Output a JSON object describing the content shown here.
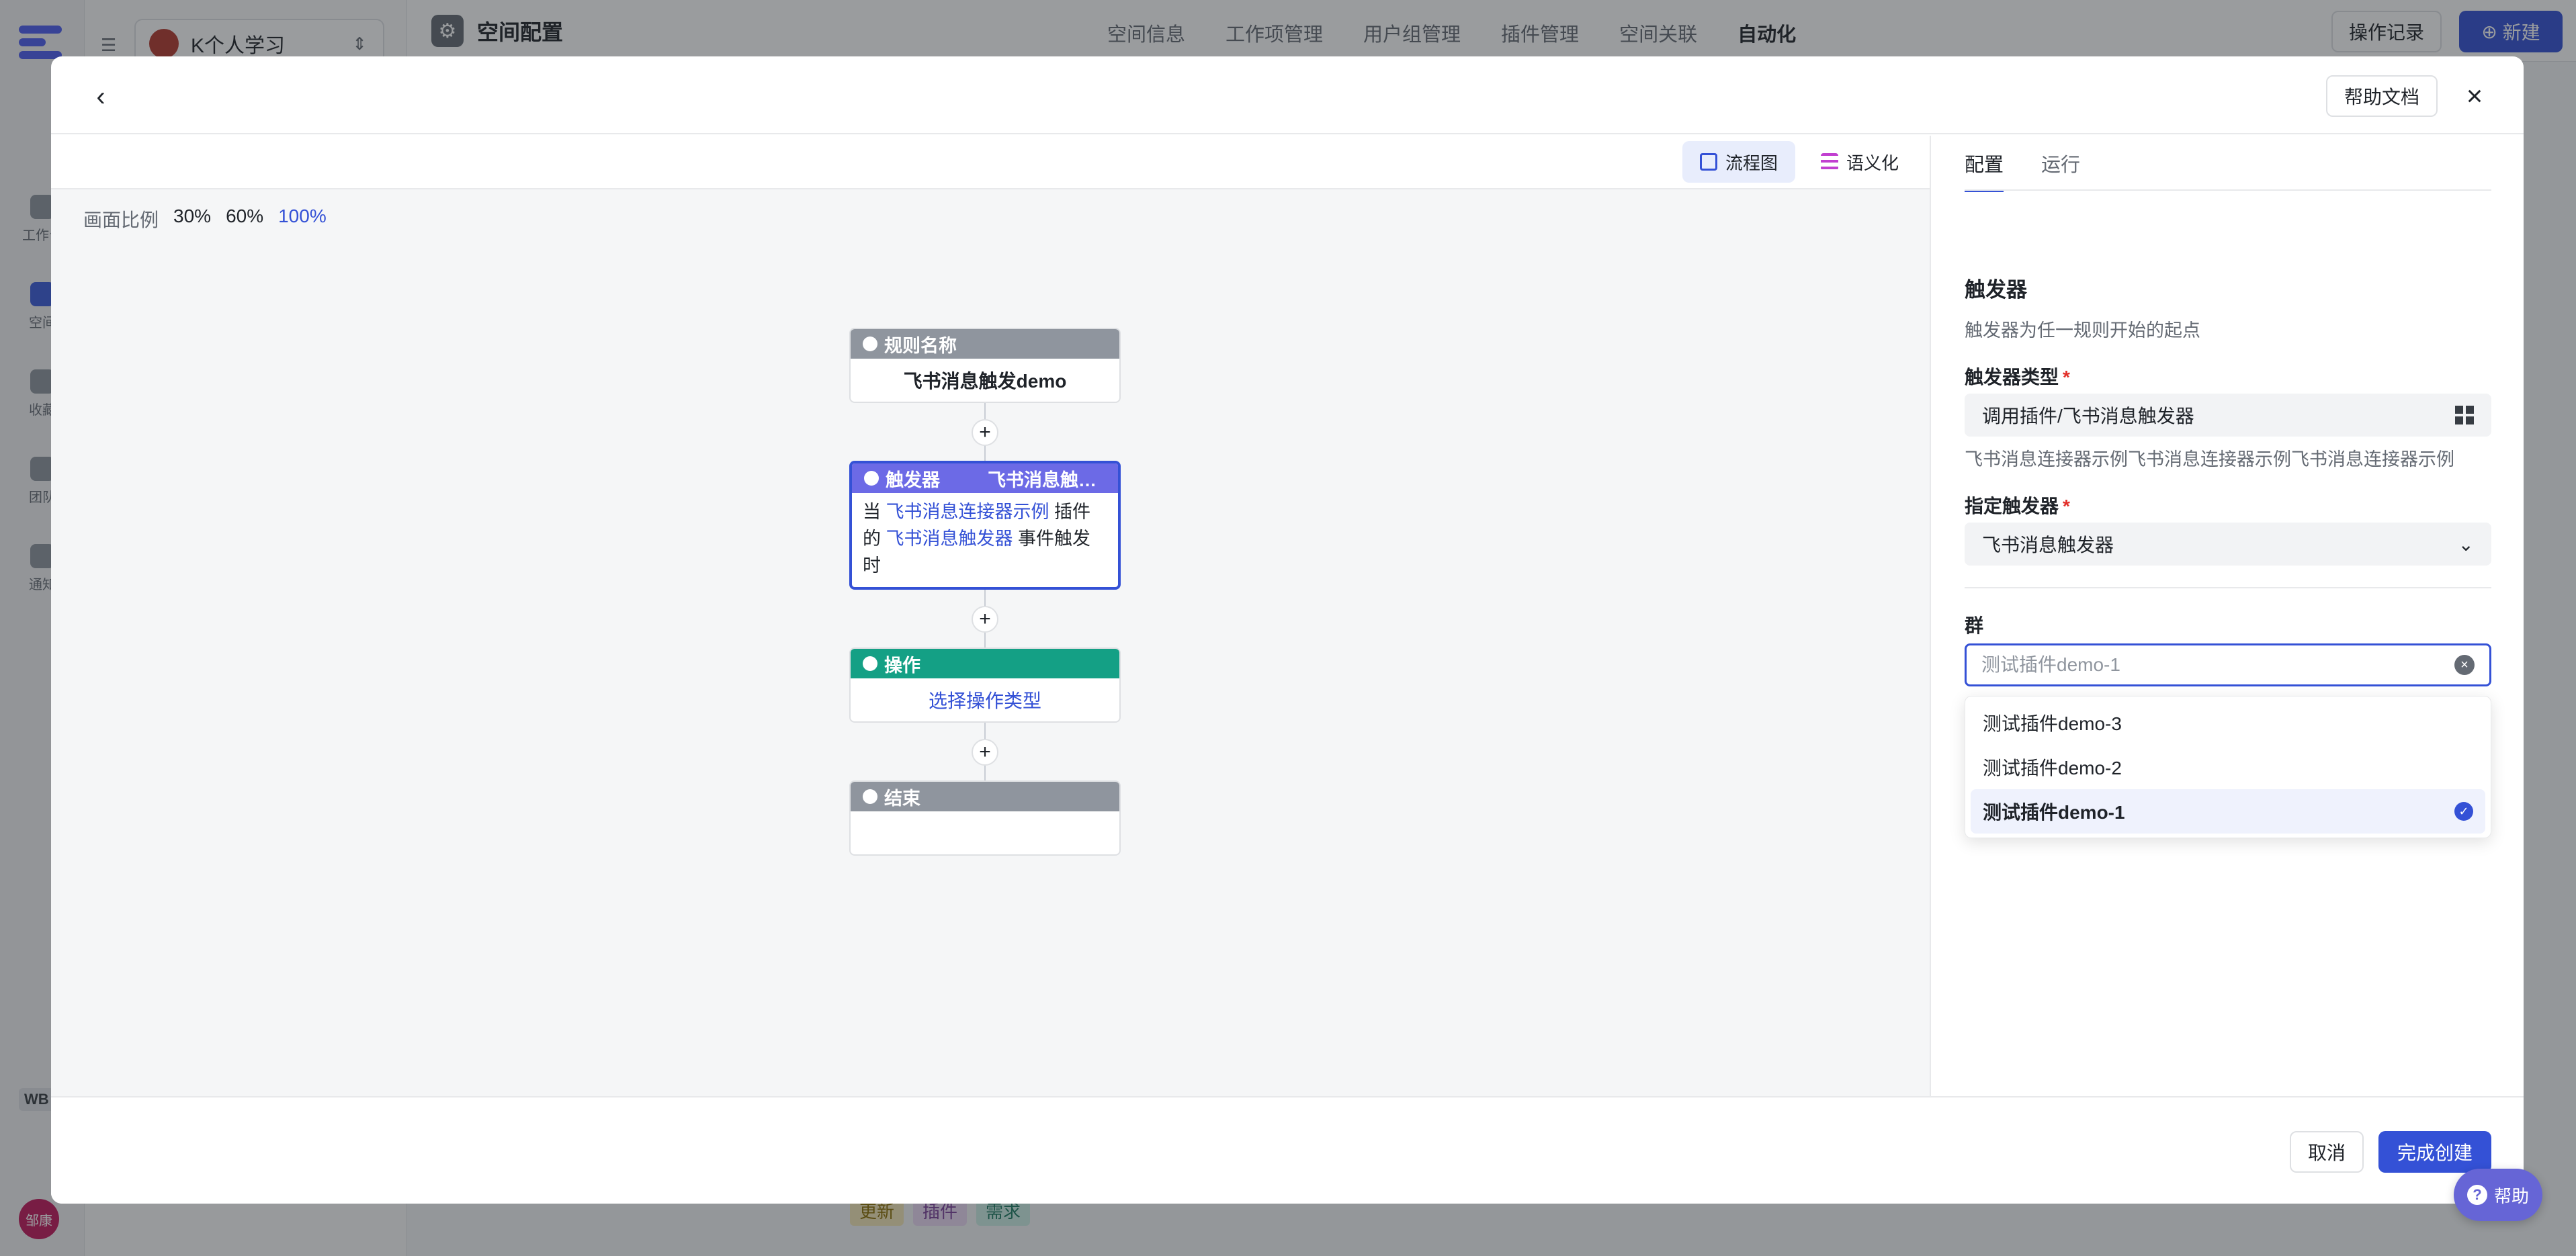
{
  "background": {
    "sidebar_items": [
      {
        "label": "工作台",
        "active": false
      },
      {
        "label": "空间",
        "active": true
      },
      {
        "label": "收藏",
        "active": false
      },
      {
        "label": "团队",
        "active": false
      },
      {
        "label": "通知",
        "active": false
      }
    ],
    "wb_label": "WB",
    "avatar_text": "邹康",
    "space_name": "K个人学习",
    "page_title": "空间配置",
    "nav": [
      "空间信息",
      "工作项管理",
      "用户组管理",
      "插件管理",
      "空间关联",
      "自动化"
    ],
    "nav_active": "自动化",
    "oplog_label": "操作记录",
    "new_label": "新建",
    "tags": [
      "更新",
      "插件",
      "需求"
    ]
  },
  "modal": {
    "help_doc_label": "帮助文档",
    "view_tabs": {
      "flow": "流程图",
      "semantic": "语义化"
    },
    "zoom": {
      "label": "画面比例",
      "options": [
        "30%",
        "60%",
        "100%"
      ],
      "active": "100%"
    },
    "flow": {
      "rule": {
        "header": "规则名称",
        "body": "飞书消息触发demo"
      },
      "trigger": {
        "header": "触发器",
        "header_sub": "飞书消息触发器",
        "text_prefix": "当",
        "plugin_link": "飞书消息连接器示例",
        "text_mid1": "插件的",
        "trigger_link": "飞书消息触发器",
        "text_suffix": "事件触发时"
      },
      "action": {
        "header": "操作",
        "body": "选择操作类型"
      },
      "end": {
        "header": "结束"
      },
      "add_symbol": "+"
    },
    "panel": {
      "tabs": [
        "配置",
        "运行"
      ],
      "section_title": "触发器",
      "section_desc": "触发器为任一规则开始的起点",
      "trigger_type_label": "触发器类型",
      "trigger_type_value": "调用插件/飞书消息触发器",
      "trigger_type_hint": "飞书消息连接器示例飞书消息连接器示例飞书消息连接器示例",
      "specify_label": "指定触发器",
      "specify_value": "飞书消息触发器",
      "group_label": "群",
      "group_placeholder": "测试插件demo-1",
      "group_options": [
        "测试插件demo-3",
        "测试插件demo-2",
        "测试插件demo-1"
      ],
      "group_selected": "测试插件demo-1",
      "required_mark": "*"
    },
    "footer": {
      "cancel_label": "取消",
      "done_label": "完成创建"
    }
  },
  "help_float_label": "帮助",
  "colors": {
    "accent": "#3451d6",
    "trigger": "#6c6ae6",
    "action": "#14a085",
    "neutral": "#8f959e"
  }
}
